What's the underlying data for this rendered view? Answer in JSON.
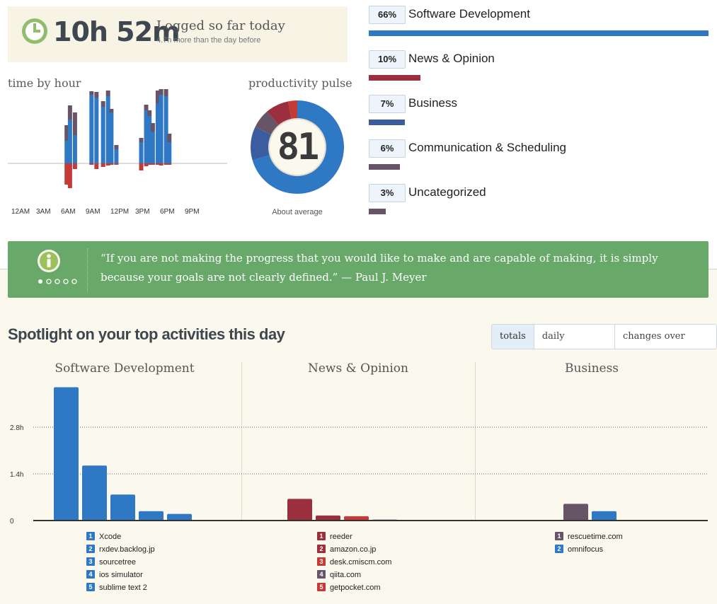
{
  "summary": {
    "time_logged": "10h 52m",
    "label": "Logged so far today",
    "comparison": "4.7h more than the day before"
  },
  "time_by_hour": {
    "title": "time by hour",
    "tick_labels": [
      "12AM",
      "3AM",
      "6AM",
      "9AM",
      "12PM",
      "3PM",
      "6PM",
      "9PM"
    ]
  },
  "pulse": {
    "title": "productivity pulse",
    "score": "81",
    "caption": "About average"
  },
  "categories": [
    {
      "pct": "66%",
      "name": "Software Development",
      "fraction": 0.66,
      "color": "#2f79c4"
    },
    {
      "pct": "10%",
      "name": "News & Opinion",
      "fraction": 0.1,
      "color": "#9c2f3d"
    },
    {
      "pct": "7%",
      "name": "Business",
      "fraction": 0.07,
      "color": "#3b5da0"
    },
    {
      "pct": "6%",
      "name": "Communication & Scheduling",
      "fraction": 0.06,
      "color": "#675567"
    },
    {
      "pct": "3%",
      "name": "Uncategorized",
      "fraction": 0.03,
      "color": "#675567"
    }
  ],
  "tip": {
    "quote": "“If you are not making the progress that you would like to make and are capable of making, it is simply because your goals are not clearly defined.” — Paul J. Meyer"
  },
  "spotlight": {
    "title": "Spotlight on your top activities this day",
    "tabs": [
      "totals",
      "daily patterns",
      "changes over time"
    ],
    "active_tab": "totals",
    "y_ticks": [
      "2.8h",
      "1.4h",
      "0"
    ]
  },
  "chart_data": [
    {
      "type": "bar",
      "title": "Software Development",
      "categories": [
        "Xcode",
        "rxdev.backlog.jp",
        "sourcetree",
        "ios simulator",
        "sublime text 2"
      ],
      "values": [
        4.0,
        1.65,
        0.78,
        0.28,
        0.2
      ],
      "ylim": [
        0,
        4.2
      ],
      "color": "#2f79c4"
    },
    {
      "type": "bar",
      "title": "News & Opinion",
      "categories": [
        "reeder",
        "amazon.co.jp",
        "desk.cmiscm.com",
        "qiita.com",
        "getpocket.com"
      ],
      "values": [
        0.65,
        0.15,
        0.13,
        0.03,
        0.02
      ],
      "ylim": [
        0,
        4.2
      ],
      "colors": [
        "#9c2f3d",
        "#9c2f3d",
        "#c43a37",
        "#675567",
        "#c43a37"
      ]
    },
    {
      "type": "bar",
      "title": "Business",
      "categories": [
        "rescuetime.com",
        "omnifocus"
      ],
      "values": [
        0.5,
        0.28
      ],
      "ylim": [
        0,
        4.2
      ],
      "colors": [
        "#675567",
        "#2f79c4"
      ]
    },
    {
      "type": "bar",
      "title": "time by hour",
      "x": [
        6,
        6.4,
        7,
        8.4,
        9,
        9.6,
        10.4,
        11,
        11.4,
        12,
        14.4,
        15,
        15.6,
        16,
        16.4,
        17,
        17.4,
        18,
        18.4,
        19.4,
        20
      ],
      "series": [
        {
          "values": [
            0.32,
            0.62,
            0.4,
            0,
            0.97,
            0.93,
            0.8,
            0.95,
            0.72,
            0.2,
            0,
            0.3,
            0.75,
            0.67,
            0.45,
            0.85,
            0.97,
            0.95,
            0.3,
            0,
            0
          ],
          "color": "#2f79c4"
        },
        {
          "values": [
            0.22,
            0.2,
            0.32,
            0,
            0.05,
            0.08,
            0.08,
            0.08,
            0.05,
            0.06,
            0,
            0.06,
            0.08,
            0.08,
            0.12,
            0.18,
            0.25,
            0.2,
            0.12,
            0,
            0
          ],
          "color": "#675567"
        },
        {
          "values": [
            -0.3,
            -0.35,
            -0.08,
            0,
            -0.02,
            -0.08,
            -0.05,
            -0.03,
            -0.02,
            -0.02,
            0,
            -0.1,
            -0.04,
            -0.02,
            -0.02,
            -0.02,
            -0.03,
            -0.02,
            -0.02,
            0,
            0
          ],
          "color": "#c43a37"
        }
      ],
      "ylim": [
        -1,
        1
      ]
    }
  ],
  "colors": {
    "accent_green": "#68a96a",
    "blue": "#2f79c4",
    "dark_red": "#9c2f3d",
    "red": "#c43a37",
    "purple": "#675567",
    "navy": "#3b5da0"
  },
  "icons": {
    "clock": "clock-icon",
    "info": "info-icon",
    "pager": "pager-dots"
  }
}
